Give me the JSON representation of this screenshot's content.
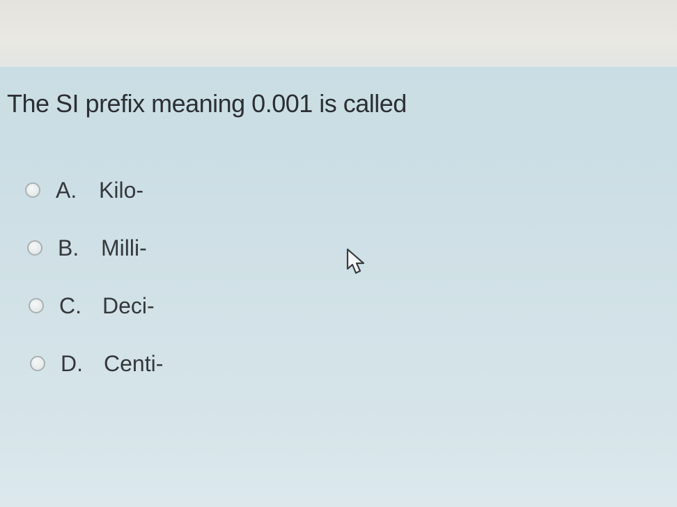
{
  "question": {
    "text": "The SI prefix meaning 0.001 is called"
  },
  "options": [
    {
      "letter": "A.",
      "label": "Kilo-"
    },
    {
      "letter": "B.",
      "label": "Milli-"
    },
    {
      "letter": "C.",
      "label": "Deci-"
    },
    {
      "letter": "D.",
      "label": "Centi-"
    }
  ],
  "cursor": {
    "icon": "mouse-pointer-icon"
  },
  "colors": {
    "panel_background": "#cfe0e6",
    "top_band": "#e7e6e0",
    "text": "#2b2f33",
    "radio_border": "#a9b1b3"
  }
}
